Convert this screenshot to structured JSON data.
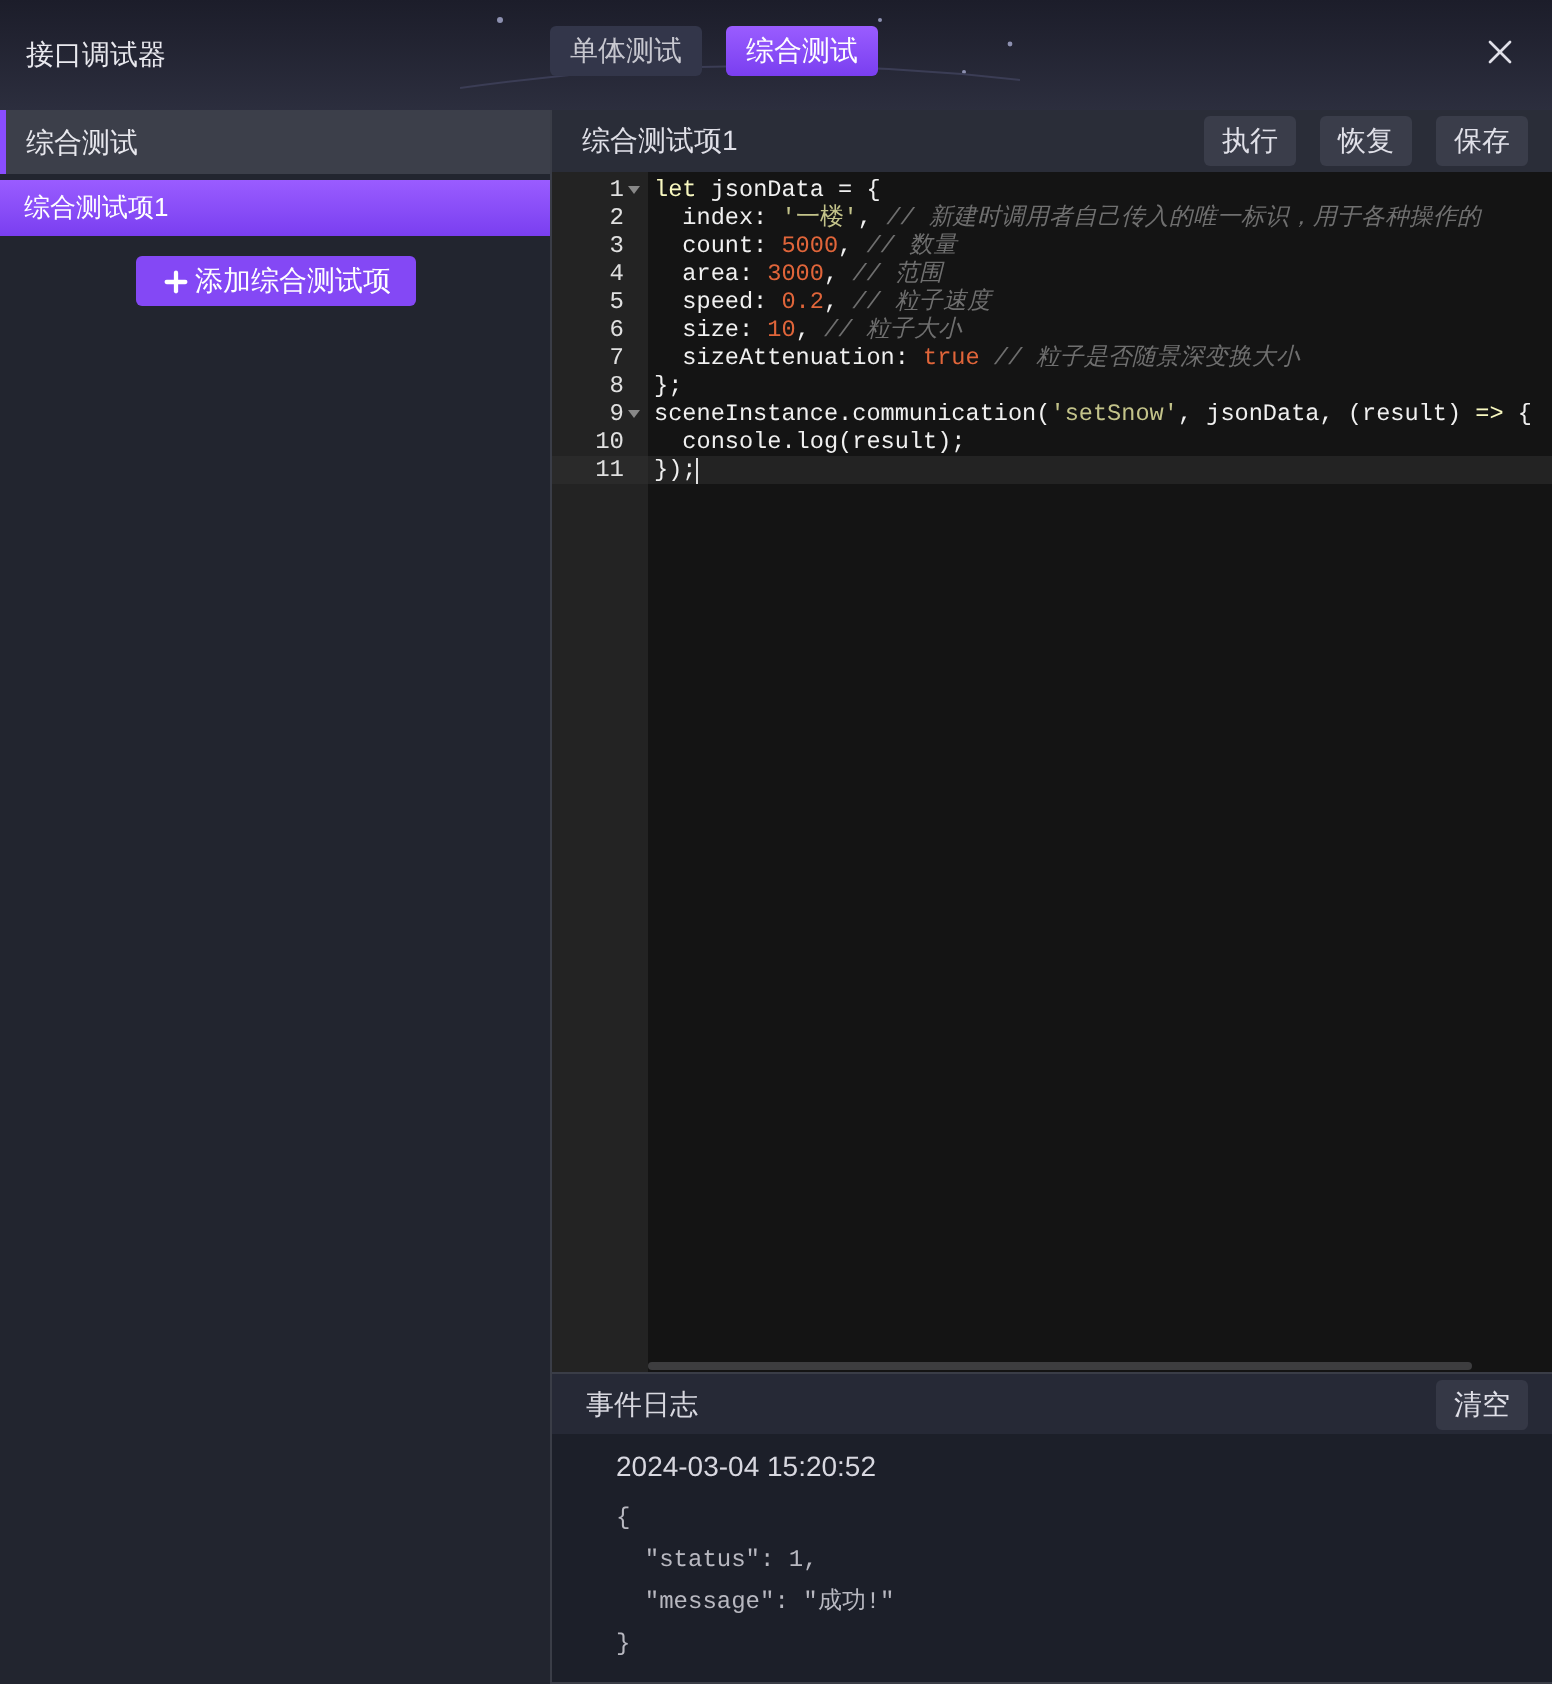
{
  "window": {
    "title": "接口调试器"
  },
  "tabs": [
    {
      "label": "单体测试",
      "selected": false
    },
    {
      "label": "综合测试",
      "selected": true
    }
  ],
  "sidebar": {
    "heading": "综合测试",
    "items": [
      {
        "label": "综合测试项1",
        "selected": true
      }
    ],
    "add_button": "添加综合测试项"
  },
  "editor": {
    "title": "综合测试项1",
    "buttons": [
      "执行",
      "恢复",
      "保存"
    ],
    "lines": [
      {
        "number": "1",
        "foldable": true,
        "active": false,
        "tokens": [
          {
            "kind": "keyword",
            "text": "let"
          },
          {
            "kind": "plain",
            "text": " jsonData = {"
          }
        ]
      },
      {
        "number": "2",
        "foldable": false,
        "active": false,
        "tokens": [
          {
            "kind": "plain",
            "text": "  index: "
          },
          {
            "kind": "string",
            "text": "'一楼'"
          },
          {
            "kind": "plain",
            "text": ", "
          },
          {
            "kind": "comment",
            "text": "// 新建时调用者自己传入的唯一标识，用于各种操作的"
          }
        ]
      },
      {
        "number": "3",
        "foldable": false,
        "active": false,
        "tokens": [
          {
            "kind": "plain",
            "text": "  count: "
          },
          {
            "kind": "number",
            "text": "5000"
          },
          {
            "kind": "plain",
            "text": ", "
          },
          {
            "kind": "comment",
            "text": "// 数量"
          }
        ]
      },
      {
        "number": "4",
        "foldable": false,
        "active": false,
        "tokens": [
          {
            "kind": "plain",
            "text": "  area: "
          },
          {
            "kind": "number",
            "text": "3000"
          },
          {
            "kind": "plain",
            "text": ", "
          },
          {
            "kind": "comment",
            "text": "// 范围"
          }
        ]
      },
      {
        "number": "5",
        "foldable": false,
        "active": false,
        "tokens": [
          {
            "kind": "plain",
            "text": "  speed: "
          },
          {
            "kind": "number",
            "text": "0.2"
          },
          {
            "kind": "plain",
            "text": ", "
          },
          {
            "kind": "comment",
            "text": "// 粒子速度"
          }
        ]
      },
      {
        "number": "6",
        "foldable": false,
        "active": false,
        "tokens": [
          {
            "kind": "plain",
            "text": "  size: "
          },
          {
            "kind": "number",
            "text": "10"
          },
          {
            "kind": "plain",
            "text": ", "
          },
          {
            "kind": "comment",
            "text": "// 粒子大小"
          }
        ]
      },
      {
        "number": "7",
        "foldable": false,
        "active": false,
        "tokens": [
          {
            "kind": "plain",
            "text": "  sizeAttenuation: "
          },
          {
            "kind": "number",
            "text": "true"
          },
          {
            "kind": "comment",
            "text": " // 粒子是否随景深变换大小"
          }
        ]
      },
      {
        "number": "8",
        "foldable": false,
        "active": false,
        "tokens": [
          {
            "kind": "plain",
            "text": "};"
          }
        ]
      },
      {
        "number": "9",
        "foldable": true,
        "active": false,
        "tokens": [
          {
            "kind": "plain",
            "text": "sceneInstance.communication("
          },
          {
            "kind": "string",
            "text": "'setSnow'"
          },
          {
            "kind": "plain",
            "text": ", jsonData, (result) "
          },
          {
            "kind": "keyword",
            "text": "=>"
          },
          {
            "kind": "plain",
            "text": " {"
          }
        ]
      },
      {
        "number": "10",
        "foldable": false,
        "active": false,
        "tokens": [
          {
            "kind": "plain",
            "text": "  console.log(result);"
          }
        ]
      },
      {
        "number": "11",
        "foldable": false,
        "active": true,
        "tokens": [
          {
            "kind": "plain",
            "text": "});"
          }
        ]
      }
    ]
  },
  "event_log": {
    "title": "事件日志",
    "clear_button": "清空",
    "entries": [
      {
        "time": "2024-03-04 15:20:52",
        "body": [
          "{",
          "  \"status\": 1,",
          "  \"message\": \"成功!\"",
          "}"
        ]
      }
    ]
  }
}
